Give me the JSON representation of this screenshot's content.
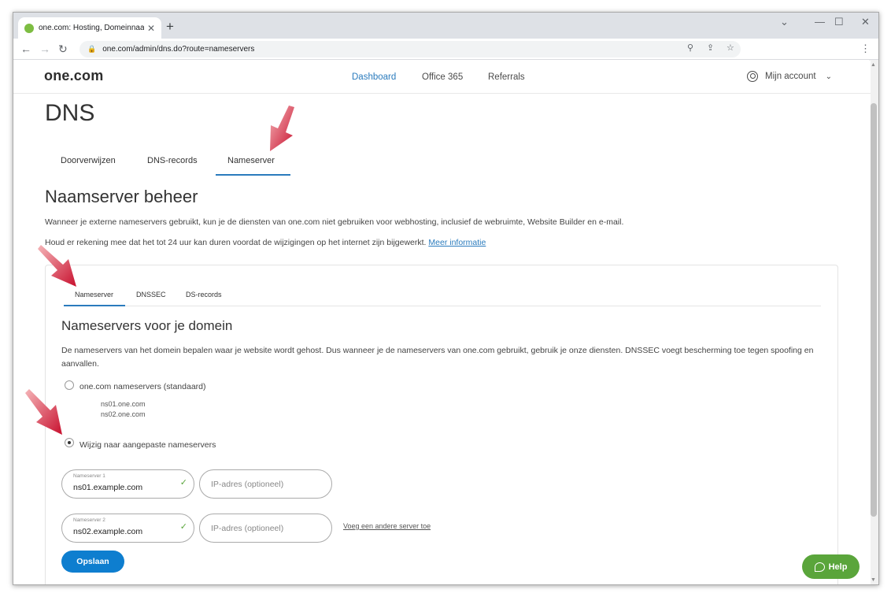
{
  "browser": {
    "tab_title": "one.com: Hosting, Domeinnaam",
    "url": "one.com/admin/dns.do?route=nameservers"
  },
  "header": {
    "logo": "one.com",
    "nav": [
      "Dashboard",
      "Office 365",
      "Referrals"
    ],
    "account": "Mijn account"
  },
  "page": {
    "title": "DNS",
    "tabs": [
      "Doorverwijzen",
      "DNS-records",
      "Nameserver"
    ],
    "section_title": "Naamserver beheer",
    "intro1": "Wanneer je externe nameservers gebruikt, kun je de diensten van one.com niet gebruiken voor webhosting, inclusief de webruimte, Website Builder en e-mail.",
    "intro2": "Houd er rekening mee dat het tot 24 uur kan duren voordat de wijzigingen op het internet zijn bijgewerkt. ",
    "more_info": "Meer informatie"
  },
  "card": {
    "tabs": [
      "Nameserver",
      "DNSSEC",
      "DS-records"
    ],
    "title": "Nameservers voor je domein",
    "description": "De nameservers van het domein bepalen waar je website wordt gehost. Dus wanneer je de nameservers van one.com gebruikt, gebruik je onze diensten. DNSSEC voegt bescherming toe tegen spoofing en aanvallen.",
    "option_default": "one.com nameservers (standaard)",
    "default_ns": [
      "ns01.one.com",
      "ns02.one.com"
    ],
    "option_custom": "Wijzig naar aangepaste nameservers",
    "ns1_label": "Nameserver 1",
    "ns1_value": "ns01.example.com",
    "ns2_label": "Nameserver 2",
    "ns2_value": "ns02.example.com",
    "ip_placeholder": "IP-adres (optioneel)",
    "add_server": "Voeg een andere server toe",
    "save": "Opslaan"
  },
  "help": "Help",
  "colors": {
    "accent": "#2a7bbd",
    "button": "#0e7ecf",
    "help": "#5aa53b",
    "arrow": "#d31f2e"
  }
}
